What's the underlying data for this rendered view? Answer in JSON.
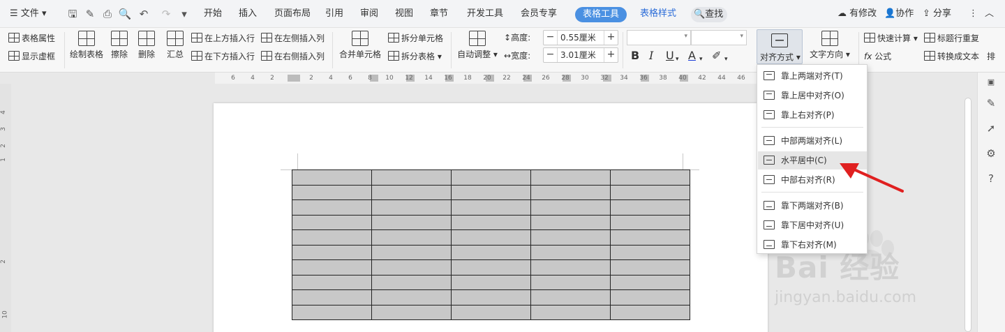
{
  "menubar": {
    "file_label": "文件",
    "tabs": [
      "开始",
      "插入",
      "页面布局",
      "引用",
      "审阅",
      "视图",
      "章节",
      "开发工具",
      "会员专享"
    ],
    "active_tab": "表格工具",
    "extra_tab": "表格样式",
    "search_label": "查找",
    "right": {
      "changes": "有修改",
      "collab": "协作",
      "share": "分享"
    }
  },
  "ribbon": {
    "table_props": "表格属性",
    "show_gridlines": "显示虚框",
    "draw_table": "绘制表格",
    "erase": "擦除",
    "delete": "删除",
    "summary": "汇总",
    "insert_above": "在上方插入行",
    "insert_below": "在下方插入行",
    "insert_left": "在左侧插入列",
    "insert_right": "在右侧插入列",
    "merge_cells": "合并单元格",
    "split_cells": "拆分单元格",
    "split_table": "拆分表格",
    "auto_fit": "自动调整",
    "height_label": "高度:",
    "height_value": "0.55厘米",
    "width_label": "宽度:",
    "width_value": "3.01厘米",
    "align_label": "对齐方式",
    "text_direction": "文字方向",
    "quick_calc": "快速计算",
    "formula": "公式",
    "repeat_header": "标题行重复",
    "convert_text": "转换成文本",
    "sort": "排"
  },
  "ruler": {
    "ticks": [
      "6",
      "4",
      "2",
      "2",
      "4",
      "6",
      "8",
      "10",
      "12",
      "14",
      "16",
      "18",
      "20",
      "22",
      "24",
      "26",
      "28",
      "30",
      "32",
      "34",
      "36",
      "38",
      "40",
      "42",
      "44",
      "46"
    ],
    "vertical_ticks": [
      "4",
      "3",
      "2",
      "1",
      "2",
      "10"
    ]
  },
  "align_menu": {
    "items": [
      {
        "label": "靠上两端对齐(T)",
        "group": "top"
      },
      {
        "label": "靠上居中对齐(O)",
        "group": "top"
      },
      {
        "label": "靠上右对齐(P)",
        "group": "top"
      },
      {
        "label": "中部两端对齐(L)",
        "group": "middle"
      },
      {
        "label": "水平居中(C)",
        "group": "middle",
        "highlighted": true
      },
      {
        "label": "中部右对齐(R)",
        "group": "middle"
      },
      {
        "label": "靠下两端对齐(B)",
        "group": "bottom"
      },
      {
        "label": "靠下居中对齐(U)",
        "group": "bottom"
      },
      {
        "label": "靠下右对齐(M)",
        "group": "bottom"
      }
    ]
  },
  "table": {
    "rows": 10,
    "cols": 5,
    "cell_fill": "#c8c8c8"
  },
  "watermark": {
    "brand": "Bai 经验",
    "url": "jingyan.baidu.com"
  },
  "colors": {
    "accent": "#4a90e2",
    "arrow": "#e02020",
    "highlight": "#e6e6e6"
  }
}
